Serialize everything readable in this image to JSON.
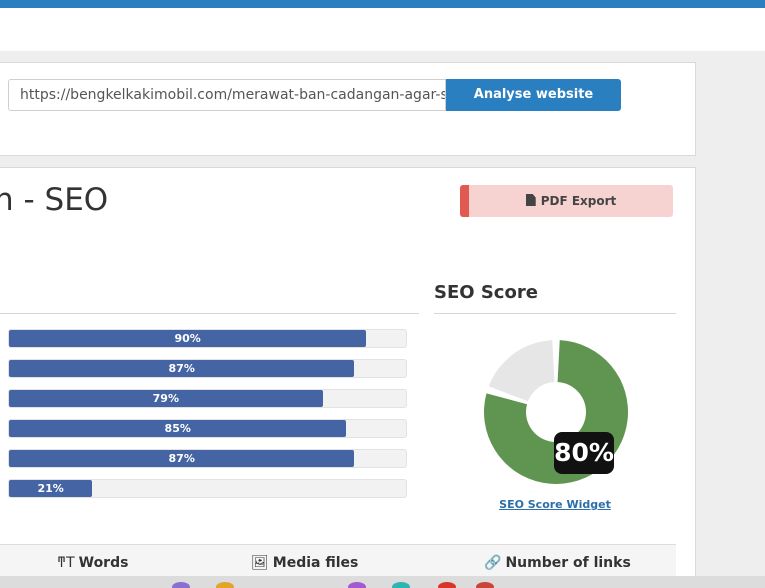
{
  "url_form": {
    "url_value": "https://bengkelkakimobil.com/merawat-ban-cadangan-agar-se",
    "analyse_label": "Analyse website"
  },
  "header": {
    "title": "n - SEO",
    "pdf_export_label": "PDF Export"
  },
  "bars": [
    {
      "label": "90%",
      "value": 90
    },
    {
      "label": "87%",
      "value": 87
    },
    {
      "label": "79%",
      "value": 79
    },
    {
      "label": "85%",
      "value": 85
    },
    {
      "label": "87%",
      "value": 87
    },
    {
      "label": "21%",
      "value": 21
    }
  ],
  "seo_score": {
    "title": "SEO Score",
    "value": 80,
    "value_label": "80%",
    "widget_link": "SEO Score Widget"
  },
  "stats": {
    "words_label": "Words",
    "media_label": "Media files",
    "links_label": "Number of links"
  },
  "colors": {
    "accent": "#2a7fc1",
    "bar": "#4464a4",
    "score_fill": "#5f9451",
    "score_rest": "#e6e6e6",
    "pdf_bg": "#f6d3d1",
    "pdf_border": "#e05a52"
  }
}
